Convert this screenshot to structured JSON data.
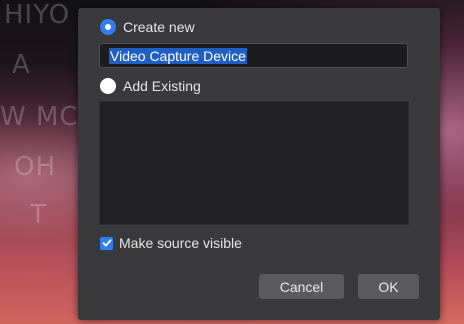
{
  "background_words": [
    "HIYO",
    "A",
    "W MC",
    "OH",
    "T"
  ],
  "dialog": {
    "create_new": {
      "label": "Create new",
      "selected": true
    },
    "name_input": {
      "value": "Video Capture Device"
    },
    "add_existing": {
      "label": "Add Existing",
      "selected": false
    },
    "existing_sources": [],
    "make_visible": {
      "label": "Make source visible",
      "checked": true
    },
    "buttons": {
      "cancel": "Cancel",
      "ok": "OK"
    }
  },
  "colors": {
    "accent": "#2f7ef3",
    "dialog_bg": "#3a3a3c"
  }
}
